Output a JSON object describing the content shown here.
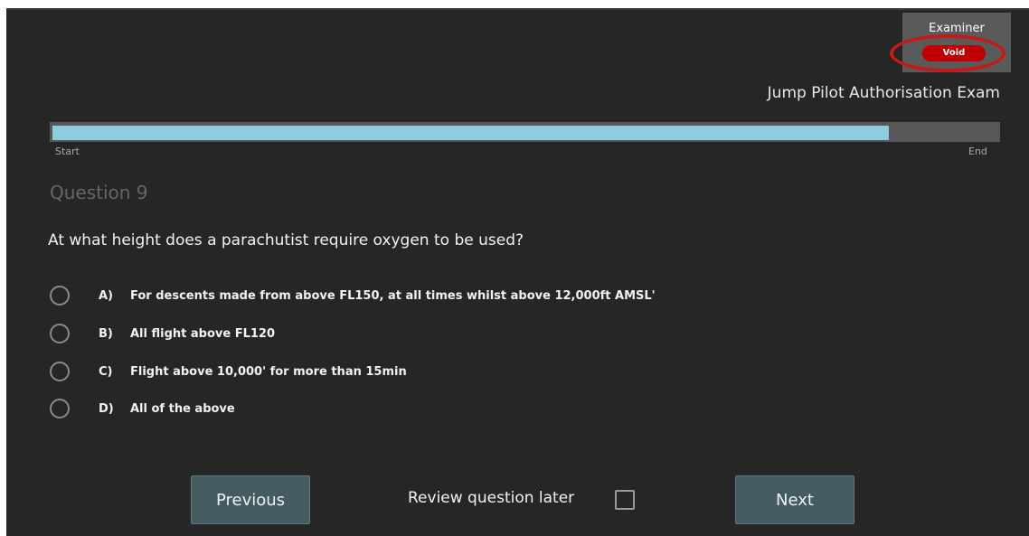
{
  "header": {
    "examiner_label": "Examiner",
    "void_label": "Void",
    "exam_title": "Jump Pilot Authorisation Exam"
  },
  "progress": {
    "start_label": "Start",
    "end_label": "End",
    "fraction": 0.885
  },
  "question": {
    "number_label": "Question 9",
    "text": "At what height does a parachutist require oxygen to be used?",
    "answers": [
      {
        "letter": "A)",
        "text": "For descents made from above FL150, at all times whilst above 12,000ft AMSL'"
      },
      {
        "letter": "B)",
        "text": "All flight above FL120"
      },
      {
        "letter": "C)",
        "text": "Flight above 10,000' for more than 15min"
      },
      {
        "letter": "D)",
        "text": "All of the above"
      }
    ]
  },
  "footer": {
    "previous_label": "Previous",
    "review_label": "Review question later",
    "next_label": "Next"
  },
  "colors": {
    "background": "#262626",
    "progress_fill": "#8ecde0",
    "void_red": "#c00000",
    "button_bg": "#445b62"
  }
}
